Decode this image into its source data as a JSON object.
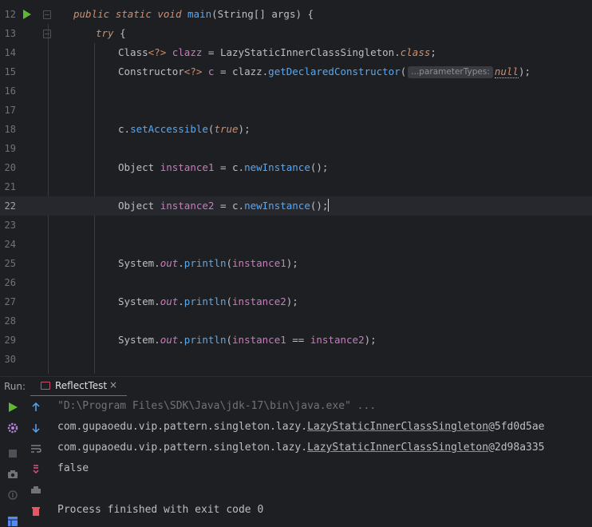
{
  "editor": {
    "current_line": 22,
    "lines": [
      {
        "n": "12",
        "indent": 92,
        "run": true,
        "fold": true,
        "tokens": [
          {
            "t": "public ",
            "c": "kw"
          },
          {
            "t": "static ",
            "c": "kw"
          },
          {
            "t": "void ",
            "c": "kw"
          },
          {
            "t": "main",
            "c": "fn"
          },
          {
            "t": "(String[] args) {",
            "c": "cls"
          }
        ]
      },
      {
        "n": "13",
        "indent": 120,
        "fold": true,
        "tokens": [
          {
            "t": "try ",
            "c": "kw"
          },
          {
            "t": "{",
            "c": "cls"
          }
        ]
      },
      {
        "n": "14",
        "indent": 148,
        "tokens": [
          {
            "t": "Class",
            "c": "cls"
          },
          {
            "t": "<?>",
            "c": "kwn"
          },
          {
            "t": " ",
            "c": "cls"
          },
          {
            "t": "clazz",
            "c": "var"
          },
          {
            "t": " = LazyStaticInnerClassSingleton.",
            "c": "cls"
          },
          {
            "t": "class",
            "c": "kw"
          },
          {
            "t": ";",
            "c": "cls"
          }
        ]
      },
      {
        "n": "15",
        "indent": 148,
        "tokens": [
          {
            "t": "Constructor",
            "c": "cls"
          },
          {
            "t": "<?>",
            "c": "kwn"
          },
          {
            "t": " ",
            "c": "cls"
          },
          {
            "t": "c",
            "c": "var"
          },
          {
            "t": " = clazz.",
            "c": "cls"
          },
          {
            "t": "getDeclaredConstructor",
            "c": "fn"
          },
          {
            "t": "(",
            "c": "cls"
          },
          {
            "t": "...parameterTypes:",
            "c": "hint"
          },
          {
            "t": "null",
            "c": "nullw"
          },
          {
            "t": ");",
            "c": "cls"
          }
        ]
      },
      {
        "n": "16",
        "indent": 148,
        "tokens": []
      },
      {
        "n": "17",
        "indent": 148,
        "tokens": []
      },
      {
        "n": "18",
        "indent": 148,
        "tokens": [
          {
            "t": "c.",
            "c": "cls"
          },
          {
            "t": "setAccessible",
            "c": "fn"
          },
          {
            "t": "(",
            "c": "cls"
          },
          {
            "t": "true",
            "c": "kw"
          },
          {
            "t": ");",
            "c": "cls"
          }
        ]
      },
      {
        "n": "19",
        "indent": 148,
        "tokens": []
      },
      {
        "n": "20",
        "indent": 148,
        "tokens": [
          {
            "t": "Object ",
            "c": "cls"
          },
          {
            "t": "instance1",
            "c": "var"
          },
          {
            "t": " = c.",
            "c": "cls"
          },
          {
            "t": "newInstance",
            "c": "fn"
          },
          {
            "t": "();",
            "c": "cls"
          }
        ]
      },
      {
        "n": "21",
        "indent": 148,
        "tokens": []
      },
      {
        "n": "22",
        "indent": 148,
        "tokens": [
          {
            "t": "Object ",
            "c": "cls"
          },
          {
            "t": "instance2",
            "c": "var"
          },
          {
            "t": " = c.",
            "c": "cls"
          },
          {
            "t": "newInstance",
            "c": "fn"
          },
          {
            "t": "();",
            "c": "cls"
          },
          {
            "t": "",
            "c": "caret"
          }
        ]
      },
      {
        "n": "23",
        "indent": 148,
        "tokens": []
      },
      {
        "n": "24",
        "indent": 148,
        "tokens": []
      },
      {
        "n": "25",
        "indent": 148,
        "tokens": [
          {
            "t": "System.",
            "c": "cls"
          },
          {
            "t": "out",
            "c": "field"
          },
          {
            "t": ".",
            "c": "cls"
          },
          {
            "t": "println",
            "c": "fn"
          },
          {
            "t": "(",
            "c": "cls"
          },
          {
            "t": "instance1",
            "c": "var"
          },
          {
            "t": ");",
            "c": "cls"
          }
        ]
      },
      {
        "n": "26",
        "indent": 148,
        "tokens": []
      },
      {
        "n": "27",
        "indent": 148,
        "tokens": [
          {
            "t": "System.",
            "c": "cls"
          },
          {
            "t": "out",
            "c": "field"
          },
          {
            "t": ".",
            "c": "cls"
          },
          {
            "t": "println",
            "c": "fn"
          },
          {
            "t": "(",
            "c": "cls"
          },
          {
            "t": "instance2",
            "c": "var"
          },
          {
            "t": ");",
            "c": "cls"
          }
        ]
      },
      {
        "n": "28",
        "indent": 148,
        "tokens": []
      },
      {
        "n": "29",
        "indent": 148,
        "tokens": [
          {
            "t": "System.",
            "c": "cls"
          },
          {
            "t": "out",
            "c": "field"
          },
          {
            "t": ".",
            "c": "cls"
          },
          {
            "t": "println",
            "c": "fn"
          },
          {
            "t": "(",
            "c": "cls"
          },
          {
            "t": "instance1",
            "c": "var"
          },
          {
            "t": " == ",
            "c": "cls"
          },
          {
            "t": "instance2",
            "c": "var"
          },
          {
            "t": ");",
            "c": "cls"
          }
        ]
      },
      {
        "n": "30",
        "indent": 148,
        "tokens": []
      }
    ]
  },
  "run_panel": {
    "label": "Run:",
    "tab_label": "ReflectTest",
    "tab_close": "×"
  },
  "console": {
    "command": "\"D:\\Program Files\\SDK\\Java\\jdk-17\\bin\\java.exe\" ...",
    "out1_prefix": "com.gupaoedu.vip.pattern.singleton.lazy.",
    "out1_class": "LazyStaticInnerClassSingleton",
    "out1_suffix": "@5fd0d5ae",
    "out2_prefix": "com.gupaoedu.vip.pattern.singleton.lazy.",
    "out2_class": "LazyStaticInnerClassSingleton",
    "out2_suffix": "@2d98a335",
    "out3": "false",
    "exit": "Process finished with exit code 0"
  },
  "colors": {
    "background": "#1e1f22",
    "keyword": "#cf8e6d",
    "method": "#56a8f5",
    "variable": "#c77dbb",
    "run_green": "#5fb832",
    "tab_accent": "#3574f0"
  },
  "icons": [
    "run-icon",
    "fold-icon",
    "rerun-icon",
    "scroll-up-icon",
    "scroll-down-icon",
    "settings-icon",
    "soft-wrap-icon",
    "stop-icon",
    "scroll-to-end-icon",
    "camera-icon",
    "print-icon",
    "pin-icon",
    "trash-icon",
    "layout-icon"
  ]
}
